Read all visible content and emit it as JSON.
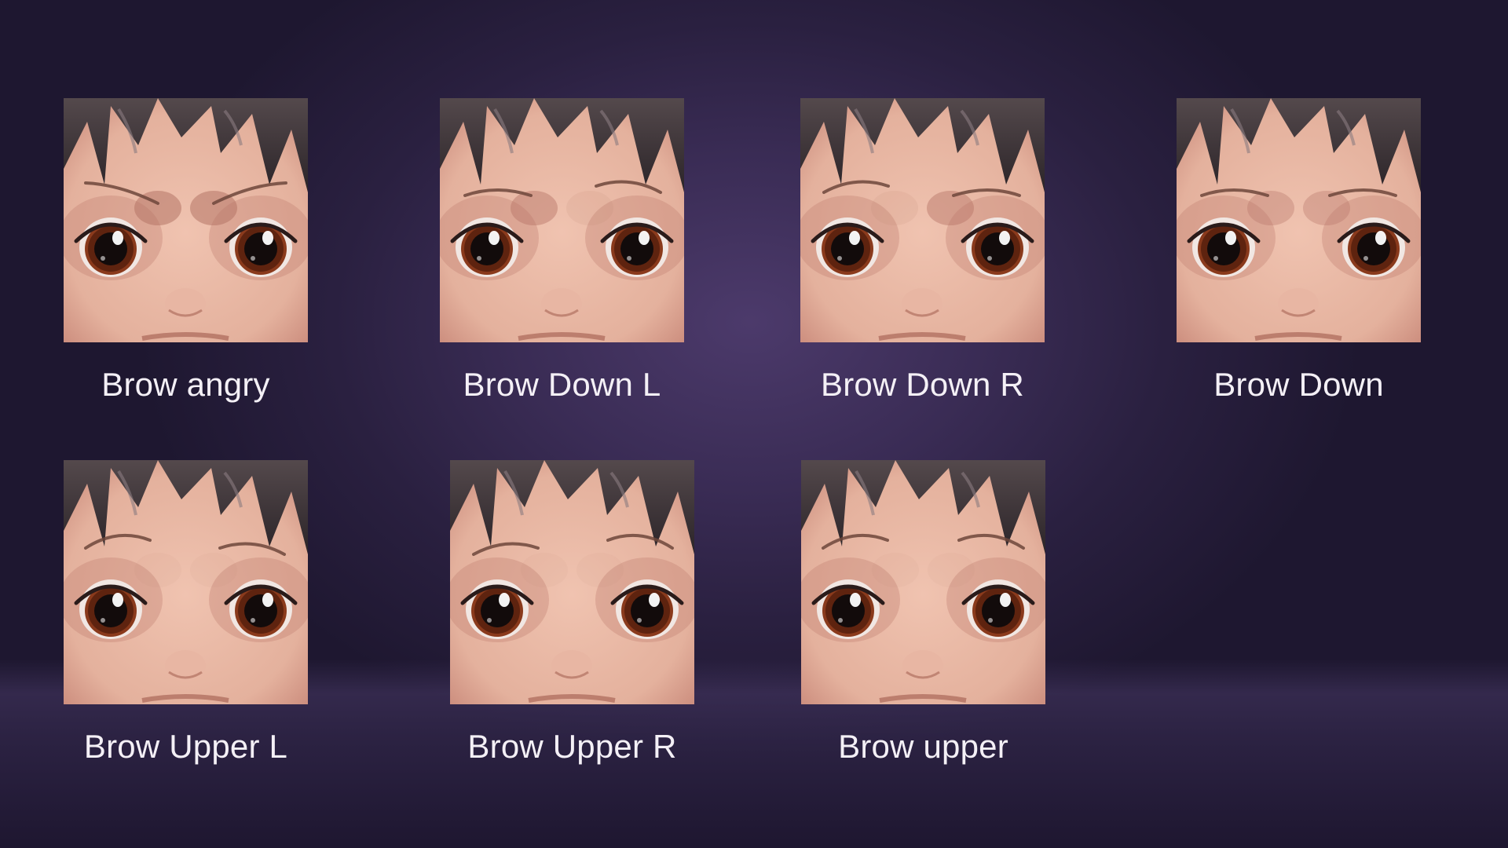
{
  "tiles": [
    {
      "label": "Brow angry",
      "brow": "angry"
    },
    {
      "label": "Brow Down L",
      "brow": "downL"
    },
    {
      "label": "Brow Down R",
      "brow": "downR"
    },
    {
      "label": "Brow Down",
      "brow": "down"
    },
    {
      "label": "Brow Upper L",
      "brow": "upL"
    },
    {
      "label": "Brow Upper R",
      "brow": "upR"
    },
    {
      "label": "Brow upper",
      "brow": "up"
    }
  ],
  "colors": {
    "hair": "#2b2428",
    "skin": "#e4b19d",
    "iris": "#8a3a1c",
    "label": "#f4f0f6"
  }
}
